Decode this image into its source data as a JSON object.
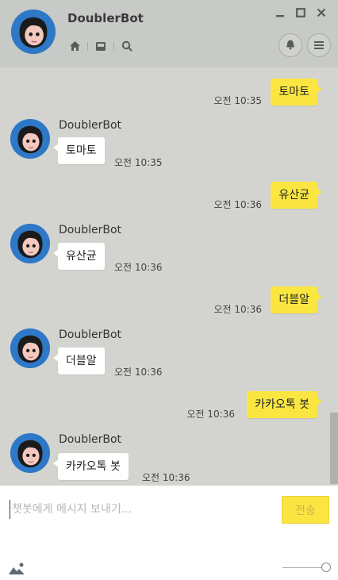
{
  "header": {
    "title": "DoublerBot"
  },
  "bot_name": "DoublerBot",
  "messages": [
    {
      "from": "me",
      "text": "토마토",
      "time": "오전 10:35"
    },
    {
      "from": "bot",
      "text": "토마토",
      "time": "오전 10:35"
    },
    {
      "from": "me",
      "text": "유산균",
      "time": "오전 10:36"
    },
    {
      "from": "bot",
      "text": "유산균",
      "time": "오전 10:36"
    },
    {
      "from": "me",
      "text": "더블알",
      "time": "오전 10:36"
    },
    {
      "from": "bot",
      "text": "더블알",
      "time": "오전 10:36"
    },
    {
      "from": "me",
      "text": "카카오톡 봇",
      "time": "오전 10:36"
    },
    {
      "from": "bot",
      "text": "카카오톡 봇",
      "time": "오전 10:36"
    }
  ],
  "input": {
    "placeholder": "챗봇에게 메시지 보내기...",
    "value": ""
  },
  "send_label": "전송",
  "colors": {
    "header_bg": "#c7cac6",
    "chat_bg": "#d3d4d0",
    "my_bubble": "#fbe641",
    "bot_bubble": "#ffffff",
    "avatar_bg": "#2e78c8"
  },
  "icons": [
    "home-icon",
    "inbox-icon",
    "search-icon",
    "minimize-icon",
    "maximize-icon",
    "close-icon",
    "bell-icon",
    "menu-icon",
    "photo-icon"
  ]
}
